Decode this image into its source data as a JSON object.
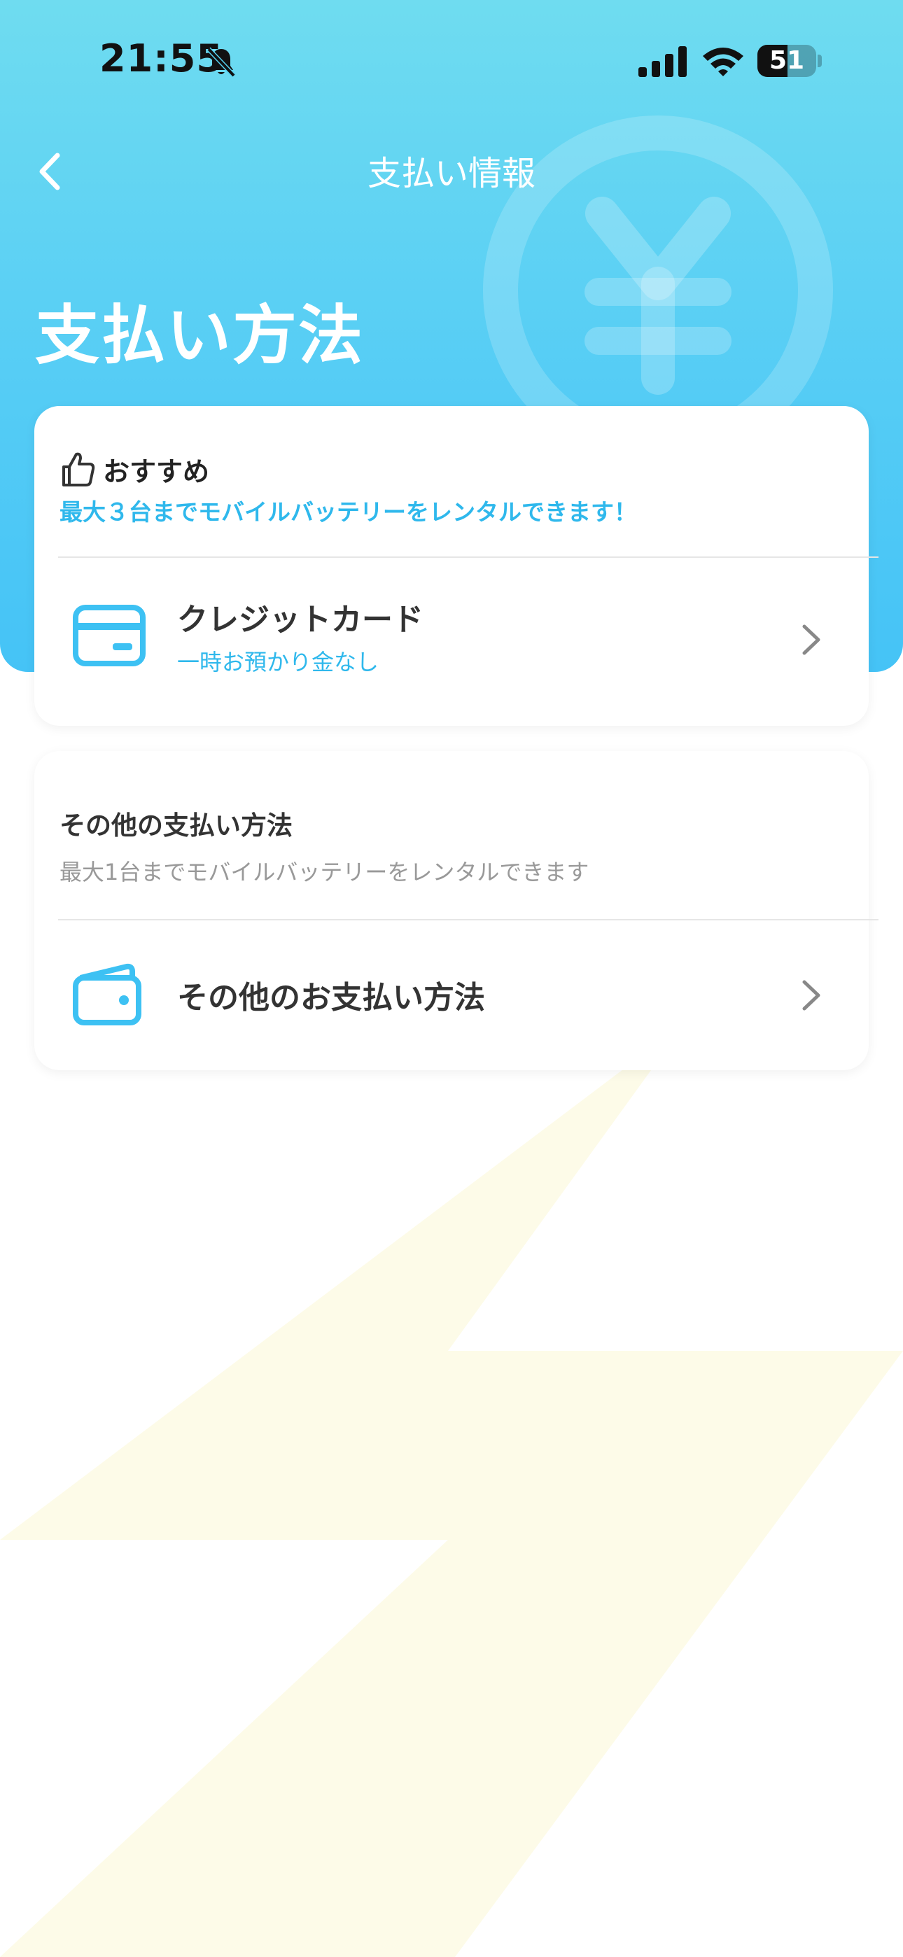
{
  "status_bar": {
    "time": "21:55",
    "battery_level": "51",
    "battery_fraction": 0.51,
    "icons": [
      "bell-slash-icon",
      "cellular-signal-icon",
      "wifi-icon",
      "battery-icon"
    ]
  },
  "header": {
    "nav_title": "支払い情報",
    "page_title": "支払い方法",
    "background_icon": "yen-coin-icon"
  },
  "recommended": {
    "label": "おすすめ",
    "note": "最大３台までモバイルバッテリーをレンタルできます！",
    "method": {
      "title": "クレジットカード",
      "subtitle": "一時お預かり金なし",
      "icon": "credit-card-icon"
    }
  },
  "other": {
    "title": "その他の支払い方法",
    "note": "最大1台までモバイルバッテリーをレンタルできます",
    "method": {
      "title": "その他のお支払い方法",
      "icon": "wallet-icon"
    }
  },
  "colors": {
    "header_top": "#6fdcf0",
    "header_bottom": "#45c3f6",
    "accent": "#2fb8ec",
    "muted_text": "#999999",
    "bolt_watermark": "#fdfbe8"
  }
}
